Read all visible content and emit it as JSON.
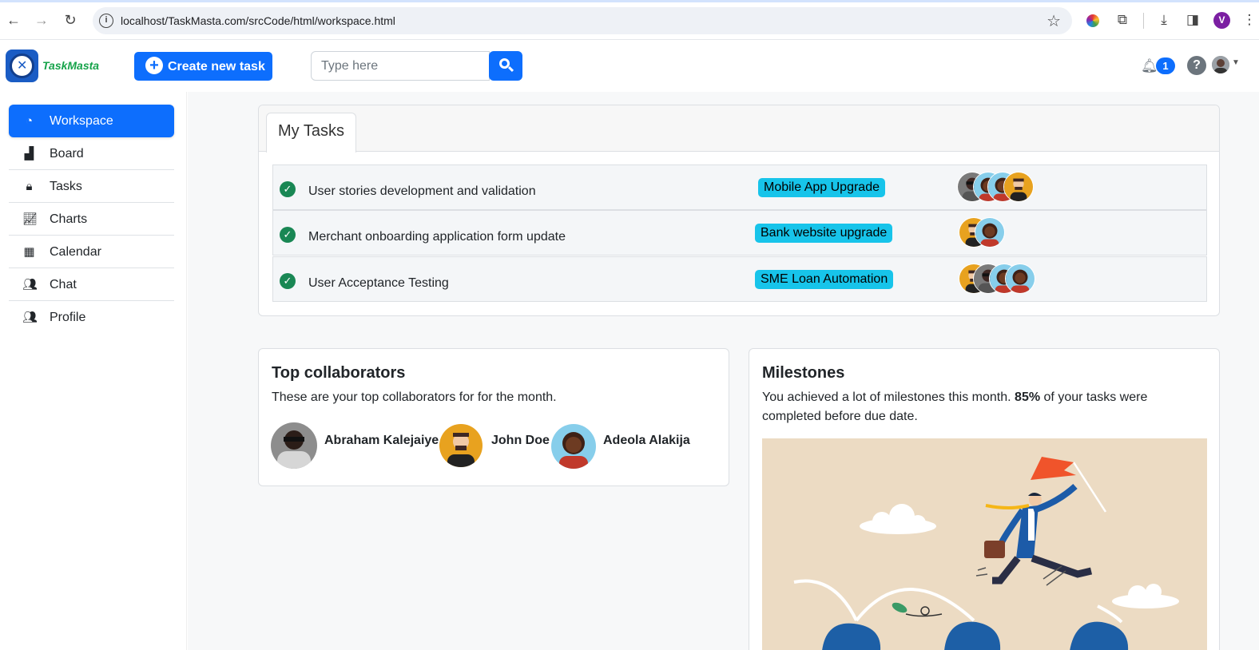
{
  "browser": {
    "url": "localhost/TaskMasta.com/srcCode/html/workspace.html",
    "profile_initial": "V"
  },
  "header": {
    "logo_text": "TaskMasta",
    "create_label": "Create new task",
    "search_placeholder": "Type here",
    "notification_count": "1",
    "help_label": "?"
  },
  "sidebar": {
    "items": [
      {
        "label": "Workspace",
        "icon": "dashboard-icon",
        "active": true
      },
      {
        "label": "Board",
        "icon": "area-chart-icon"
      },
      {
        "label": "Tasks",
        "icon": "lock-icon"
      },
      {
        "label": "Charts",
        "icon": "line-chart-icon"
      },
      {
        "label": "Calendar",
        "icon": "calendar-icon"
      },
      {
        "label": "Chat",
        "icon": "users-icon"
      },
      {
        "label": "Profile",
        "icon": "users-icon"
      }
    ]
  },
  "my_tasks": {
    "tab_label": "My Tasks",
    "rows": [
      {
        "title": "User stories development and validation",
        "project": "Mobile App Upgrade",
        "assignees": 4
      },
      {
        "title": "Merchant onboarding application form update",
        "project": "Bank website upgrade",
        "assignees": 2
      },
      {
        "title": "User Acceptance Testing",
        "project": "SME Loan Automation",
        "assignees": 4
      }
    ]
  },
  "collaborators": {
    "title": "Top collaborators",
    "description": "These are your top collaborators for for the month.",
    "people": [
      {
        "name": "Abraham Kalejaiye"
      },
      {
        "name": "John Doe"
      },
      {
        "name": "Adeola Alakija"
      }
    ]
  },
  "milestones": {
    "title": "Milestones",
    "text_before": "You achieved a lot of milestones this month. ",
    "percent": "85%",
    "text_after": " of your tasks were completed before due date."
  },
  "colors": {
    "primary": "#0d6efd",
    "badge": "#17c4ea",
    "success": "#198754",
    "logo_green": "#16a34a"
  }
}
